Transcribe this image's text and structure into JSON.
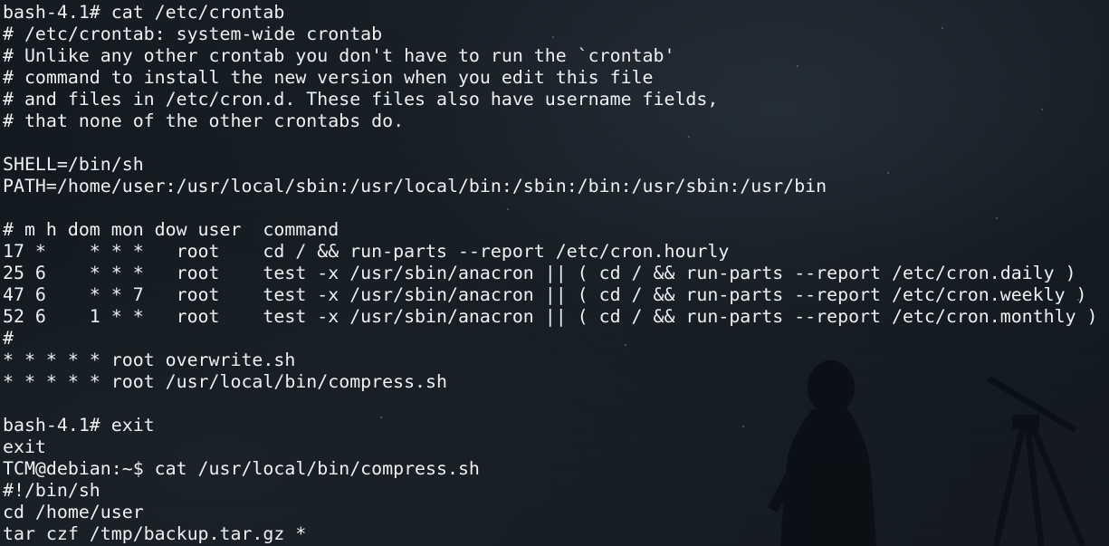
{
  "terminal": {
    "lines": [
      "bash-4.1# cat /etc/crontab",
      "# /etc/crontab: system-wide crontab",
      "# Unlike any other crontab you don't have to run the `crontab'",
      "# command to install the new version when you edit this file",
      "# and files in /etc/cron.d. These files also have username fields,",
      "# that none of the other crontabs do.",
      "",
      "SHELL=/bin/sh",
      "PATH=/home/user:/usr/local/sbin:/usr/local/bin:/sbin:/bin:/usr/sbin:/usr/bin",
      "",
      "# m h dom mon dow user  command",
      "17 *    * * *   root    cd / && run-parts --report /etc/cron.hourly",
      "25 6    * * *   root    test -x /usr/sbin/anacron || ( cd / && run-parts --report /etc/cron.daily )",
      "47 6    * * 7   root    test -x /usr/sbin/anacron || ( cd / && run-parts --report /etc/cron.weekly )",
      "52 6    1 * *   root    test -x /usr/sbin/anacron || ( cd / && run-parts --report /etc/cron.monthly )",
      "#",
      "* * * * * root overwrite.sh",
      "* * * * * root /usr/local/bin/compress.sh",
      "",
      "bash-4.1# exit",
      "exit",
      "TCM@debian:~$ cat /usr/local/bin/compress.sh",
      "#!/bin/sh",
      "cd /home/user",
      "tar czf /tmp/backup.tar.gz *"
    ]
  },
  "colors": {
    "text": "#f0f0f0",
    "background": "#10161c",
    "silhouette": "#0a0f14"
  }
}
